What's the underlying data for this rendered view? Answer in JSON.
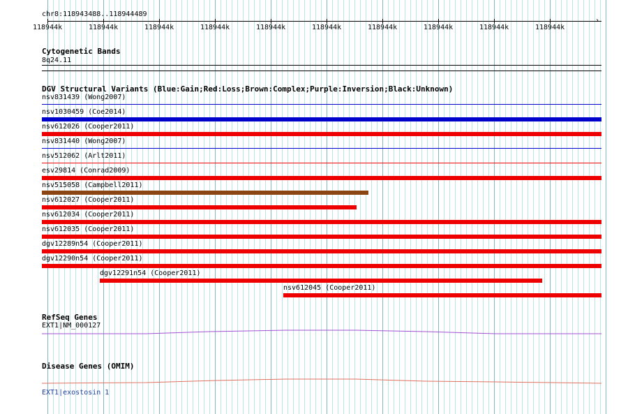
{
  "location": "chr8:118943488..118944489",
  "ruler": {
    "ticks": [
      "118944k",
      "118944k",
      "118944k",
      "118944k",
      "118944k",
      "118944k",
      "118944k",
      "118944k",
      "118944k",
      "118944k"
    ]
  },
  "cytoband": {
    "title": "Cytogenetic Bands",
    "label": "8q24.11"
  },
  "dgv": {
    "title": "DGV Structural Variants (Blue:Gain;Red:Loss;Brown:Complex;Purple:Inversion;Black:Unknown)",
    "legend_colors": {
      "gain": "#0000cc",
      "loss": "#ee0000",
      "complex": "#8b4513",
      "purple": "#800080",
      "unknown": "#000000"
    },
    "features": [
      {
        "label": "nsv831439 (Wong2007)",
        "type": "gain",
        "thin": true,
        "start": 0,
        "end": 100
      },
      {
        "label": "nsv1030459 (Coe2014)",
        "type": "gain",
        "thin": false,
        "start": 0,
        "end": 100
      },
      {
        "label": "nsv612026 (Cooper2011)",
        "type": "loss",
        "thin": false,
        "start": 0,
        "end": 100
      },
      {
        "label": "nsv831440 (Wong2007)",
        "type": "gain",
        "thin": true,
        "start": 0,
        "end": 100
      },
      {
        "label": "nsv512062 (Arlt2011)",
        "type": "loss",
        "thin": true,
        "start": 0,
        "end": 100
      },
      {
        "label": "esv29814 (Conrad2009)",
        "type": "loss",
        "thin": false,
        "start": 0,
        "end": 100
      },
      {
        "label": "nsv515058 (Campbell2011)",
        "type": "complex",
        "thin": false,
        "start": 0,
        "end": 58.3
      },
      {
        "label": "nsv612027 (Cooper2011)",
        "type": "loss",
        "thin": false,
        "start": 0,
        "end": 56.2
      },
      {
        "label": "nsv612034 (Cooper2011)",
        "type": "loss",
        "thin": false,
        "start": 0,
        "end": 100
      },
      {
        "label": "nsv612035 (Cooper2011)",
        "type": "loss",
        "thin": false,
        "start": 0,
        "end": 100
      },
      {
        "label": "dgv12289n54 (Cooper2011)",
        "type": "loss",
        "thin": false,
        "start": 0,
        "end": 100
      },
      {
        "label": "dgv12290n54 (Cooper2011)",
        "type": "loss",
        "thin": false,
        "start": 0,
        "end": 100
      },
      {
        "label": "dgv12291n54 (Cooper2011)",
        "type": "loss",
        "thin": false,
        "start": 10.3,
        "end": 89.3
      },
      {
        "label": "nsv612045 (Cooper2011)",
        "type": "loss",
        "thin": false,
        "start": 43.2,
        "end": 100
      }
    ]
  },
  "refseq": {
    "title": "RefSeq Genes",
    "label": "EXT1|NM_000127",
    "color": "#a050d0"
  },
  "omim": {
    "title": "Disease Genes (OMIM)",
    "label": "EXT1|exostosin 1",
    "color": "#e07060"
  }
}
